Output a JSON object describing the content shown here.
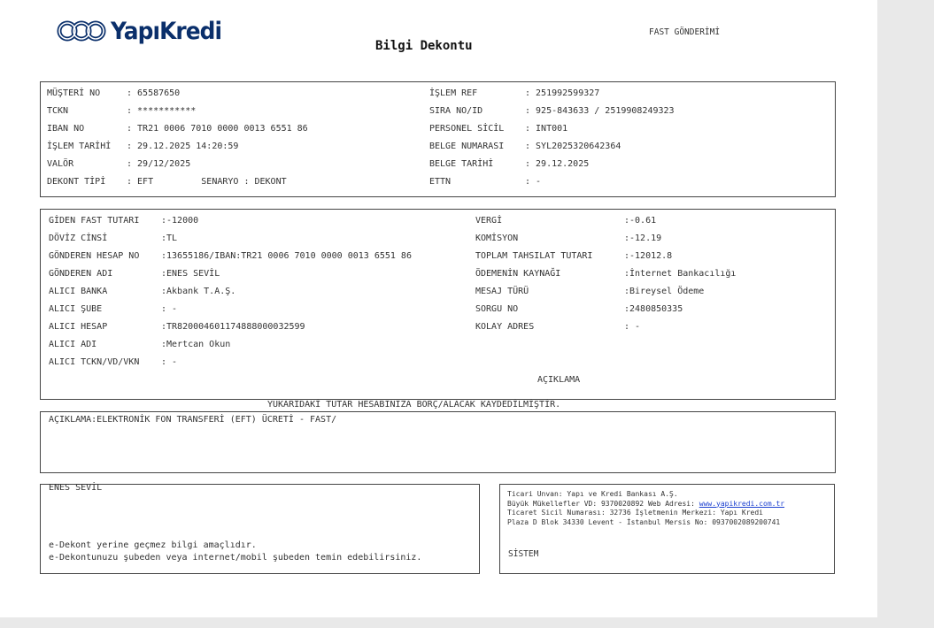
{
  "header": {
    "brand": "YapıKredi",
    "doc_type": "FAST GÖNDERİMİ",
    "title": "Bilgi Dekontu"
  },
  "customer_block": {
    "left": [
      {
        "label": "MÜŞTERİ NO  ",
        "value": ": 65587650"
      },
      {
        "label": "TCKN        ",
        "value": ": ***********"
      },
      {
        "label": "IBAN NO     ",
        "value": ": TR21 0006 7010 0000 0013 6551 86"
      },
      {
        "label": "İŞLEM TARİHİ",
        "value": ": 29.12.2025 14:20:59"
      },
      {
        "label": "VALÖR       ",
        "value": ": 29/12/2025"
      },
      {
        "label": "DEKONT TİPİ ",
        "value": ": EFT         SENARYO : DEKONT"
      }
    ],
    "right": [
      {
        "label": "İŞLEM REF      ",
        "value": ": 251992599327"
      },
      {
        "label": "SIRA NO/ID     ",
        "value": ": 925-843633 / 2519908249323"
      },
      {
        "label": "PERSONEL SİCİL ",
        "value": ": INT001"
      },
      {
        "label": "BELGE NUMARASI ",
        "value": ": SYL2025320642364"
      },
      {
        "label": "BELGE TARİHİ   ",
        "value": ": 29.12.2025"
      },
      {
        "label": "ETTN           ",
        "value": ": -"
      }
    ]
  },
  "transfer_block": {
    "left": [
      {
        "label": "GİDEN FAST TUTARI ",
        "value": ":-12000"
      },
      {
        "label": "DÖVİZ CİNSİ       ",
        "value": ":TL"
      },
      {
        "label": "GÖNDEREN HESAP NO ",
        "value": ":13655186/IBAN:TR21 0006 7010 0000 0013 6551 86"
      },
      {
        "label": "GÖNDEREN ADI      ",
        "value": ":ENES SEVİL"
      },
      {
        "label": "ALICI BANKA       ",
        "value": ":Akbank T.A.Ş."
      },
      {
        "label": "ALICI ŞUBE        ",
        "value": ": -"
      },
      {
        "label": "ALICI HESAP       ",
        "value": ":TR820004601174888000032599"
      },
      {
        "label": "ALICI ADI         ",
        "value": ":Mertcan Okun"
      },
      {
        "label": "ALICI TCKN/VD/VKN ",
        "value": ": -"
      }
    ],
    "right": [
      {
        "label": "VERGİ                 ",
        "value": ":-0.61"
      },
      {
        "label": "KOMİSYON              ",
        "value": ":-12.19"
      },
      {
        "label": "TOPLAM TAHSILAT TUTARI",
        "value": ":-12012.8"
      },
      {
        "label": "ÖDEMENİN KAYNAĞI      ",
        "value": ":İnternet Bankacılığı"
      },
      {
        "label": "MESAJ TÜRÜ            ",
        "value": ":Bireysel Ödeme"
      },
      {
        "label": "SORGU NO              ",
        "value": ":2480850335"
      },
      {
        "label": "KOLAY ADRES           ",
        "value": ": -"
      }
    ],
    "aciklama_label": "AÇIKLAMA"
  },
  "notice": "YUKARIDAKİ TUTAR HESABINIZA BORÇ/ALACAK KAYDEDİLMİŞTİR.",
  "description": "AÇIKLAMA:ELEKTRONİK FON TRANSFERİ (EFT) ÜCRETİ - FAST/",
  "footer_left": {
    "name": "ENES SEVİL",
    "line1": "e-Dekont yerine geçmez bilgi amaçlıdır.",
    "line2": "e-Dekontunuzu şubeden veya internet/mobil şubeden temin edebilirsiniz."
  },
  "footer_right": {
    "line1": "Ticari Unvan: Yapı ve Kredi Bankası A.Ş.",
    "line2_prefix": "Büyük Mükellefler VD: 9370020892 Web Adresi: ",
    "web": "www.yapikredi.com.tr",
    "line3": "Ticaret Sicil Numarası: 32736 İşletmenin Merkezi: Yapı Kredi",
    "line4": "Plaza D Blok 34330 Levent - İstanbul Mersis No: 0937002089200741",
    "system": "SİSTEM"
  },
  "colors": {
    "brand": "#0a2f6b",
    "link": "#1a3fd0"
  }
}
